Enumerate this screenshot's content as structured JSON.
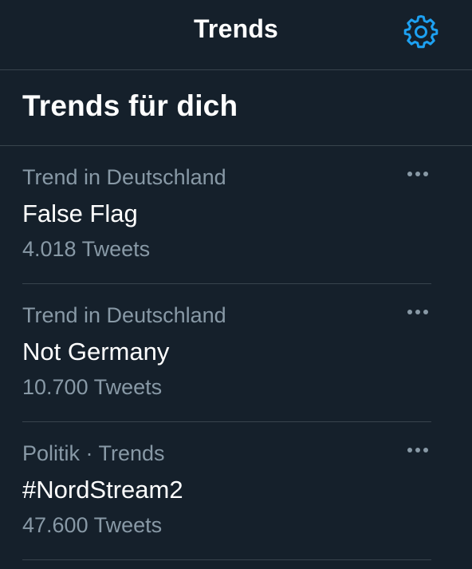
{
  "header": {
    "title": "Trends",
    "settings_icon": "gear-icon",
    "accent_color": "#1da1f2"
  },
  "section": {
    "title": "Trends für dich"
  },
  "trends": [
    {
      "meta": "Trend in Deutschland",
      "name": "False Flag",
      "count": "4.018 Tweets"
    },
    {
      "meta": "Trend in Deutschland",
      "name": "Not Germany",
      "count": "10.700 Tweets"
    },
    {
      "meta": "Politik · Trends",
      "name": "#NordStream2",
      "count": "47.600 Tweets"
    }
  ],
  "colors": {
    "background": "#15202b",
    "primary_text": "#ffffff",
    "secondary_text": "#8899a6",
    "divider": "#38444d"
  }
}
